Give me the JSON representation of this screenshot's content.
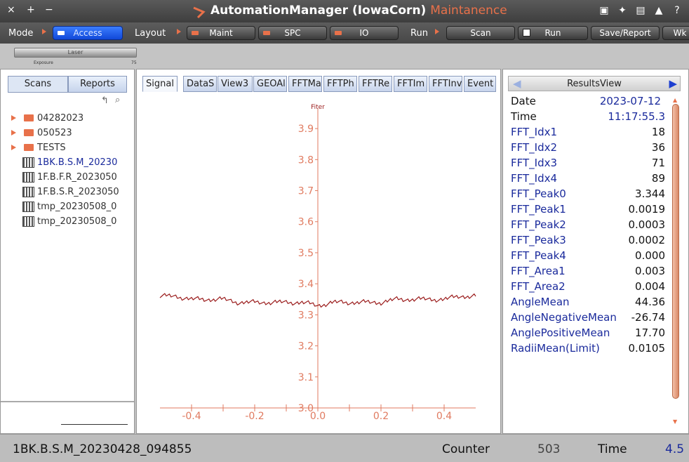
{
  "window": {
    "close": "×",
    "add": "+",
    "minimize": "−",
    "app": "AutomationManager (IowaCorn)",
    "mode": "Maintanence"
  },
  "title_icons": [
    "save-icon",
    "tools-icon",
    "windows-icon",
    "lock-icon",
    "help-icon"
  ],
  "toolbar": {
    "mode_label": "Mode",
    "access_label": "Access",
    "layout_label": "Layout",
    "maint_label": "Maint",
    "spc_label": "SPC",
    "io_label": "IO",
    "run_label": "Run",
    "scan_label": "Scan",
    "run_button_label": "Run",
    "save_report_label": "Save/Report",
    "wk_label": "Wk"
  },
  "slider": {
    "label": "Laser",
    "sub_label": "Exposure",
    "value": "75"
  },
  "left_tabs": {
    "scans": "Scans",
    "reports": "Reports"
  },
  "tree": {
    "folders": [
      "04282023",
      "050523",
      "TESTS"
    ],
    "files": [
      "1BK.B.S.M_20230",
      "1F.B.F.R_2023050",
      "1F.B.S.R_2023050",
      "tmp_20230508_0",
      "tmp_20230508_0"
    ]
  },
  "center_tabs": [
    "Signal",
    "DataS",
    "View3",
    "GEOAl",
    "FFTMa",
    "FFTPh",
    "FFTRe",
    "FFTIm",
    "FFTInv",
    "Event"
  ],
  "chart_data": {
    "type": "line",
    "title": "Fiter",
    "ylim": [
      3.0,
      3.95
    ],
    "xlim": [
      -0.5,
      0.5
    ],
    "yticks": [
      "3.0",
      "3.1",
      "3.2",
      "3.3",
      "3.4",
      "3.5",
      "3.6",
      "3.7",
      "3.8",
      "3.9"
    ],
    "xticks": [
      "-0.4",
      "-0.2",
      "0.0",
      "0.2",
      "0.4"
    ],
    "series": [
      {
        "x": [
          -0.5,
          -0.45,
          -0.4,
          -0.35,
          -0.3,
          -0.25,
          -0.2,
          -0.15,
          -0.1,
          -0.05,
          0,
          0.05,
          0.1,
          0.15,
          0.2,
          0.25,
          0.3,
          0.35,
          0.4,
          0.45,
          0.5
        ],
        "y": [
          3.36,
          3.36,
          3.35,
          3.35,
          3.35,
          3.34,
          3.34,
          3.34,
          3.34,
          3.34,
          3.33,
          3.34,
          3.34,
          3.34,
          3.34,
          3.35,
          3.35,
          3.35,
          3.35,
          3.36,
          3.36
        ]
      }
    ],
    "color": "#e07a5f",
    "line_color": "#9a1b1b"
  },
  "results": {
    "title": "ResultsView",
    "date_label": "Date",
    "date": "2023-07-12",
    "time_label": "Time",
    "time": "11:17:55.3",
    "rows": [
      {
        "k": "FFT_Idx1",
        "v": "18"
      },
      {
        "k": "FFT_Idx2",
        "v": "36"
      },
      {
        "k": "FFT_Idx3",
        "v": "71"
      },
      {
        "k": "FFT_Idx4",
        "v": "89"
      },
      {
        "k": "FFT_Peak0",
        "v": "3.344"
      },
      {
        "k": "FFT_Peak1",
        "v": "0.0019"
      },
      {
        "k": "FFT_Peak2",
        "v": "0.0003"
      },
      {
        "k": "FFT_Peak3",
        "v": "0.0002"
      },
      {
        "k": "FFT_Peak4",
        "v": "0.000"
      },
      {
        "k": "FFT_Area1",
        "v": "0.003"
      },
      {
        "k": "FFT_Area2",
        "v": "0.004"
      },
      {
        "k": "AngleMean",
        "v": "44.36"
      },
      {
        "k": "AngleNegativeMean",
        "v": "-26.74"
      },
      {
        "k": "AnglePositiveMean",
        "v": "17.70"
      },
      {
        "k": "RadiiMean(Limit)",
        "v": "0.0105"
      }
    ]
  },
  "status": {
    "file": "1BK.B.S.M_20230428_094855",
    "counter_label": "Counter",
    "counter": "503",
    "time_label": "Time",
    "time": "4.5"
  }
}
